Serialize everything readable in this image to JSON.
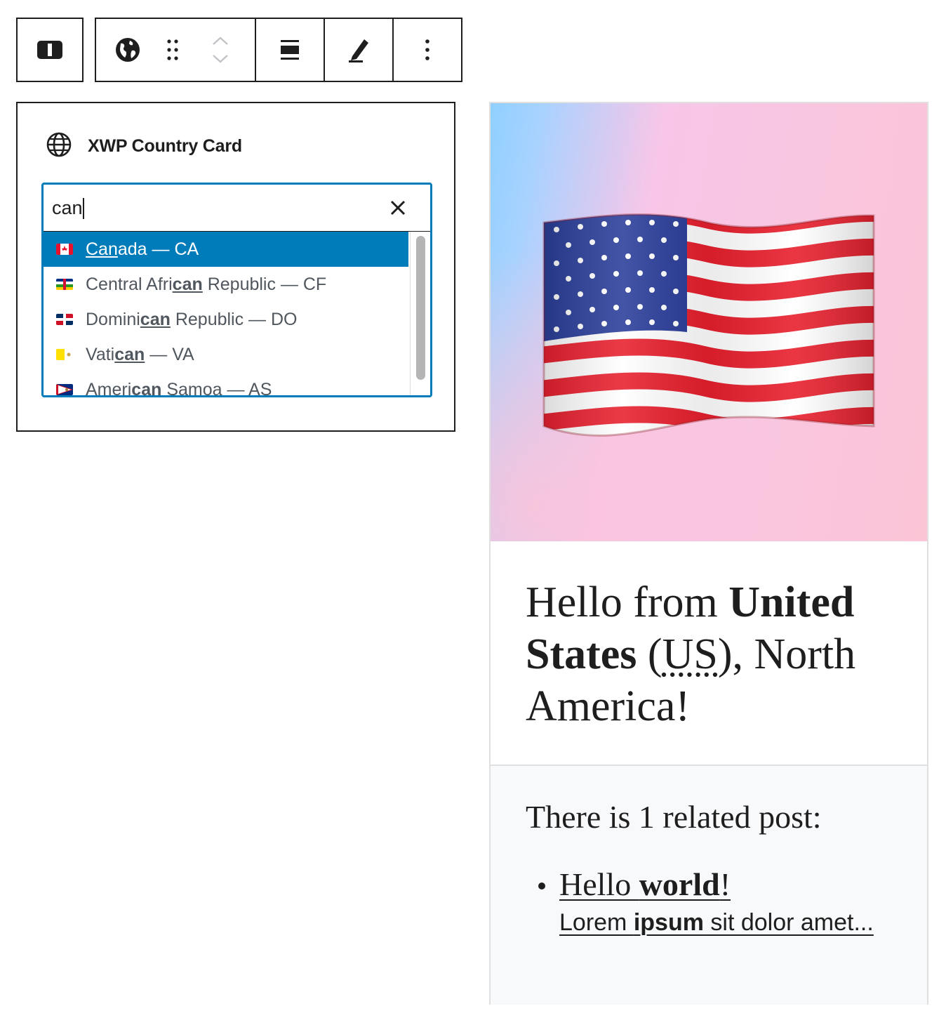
{
  "toolbar": {
    "parent_icon": "block-parent-icon",
    "block_icon": "globe-filled-icon",
    "drag_icon": "drag-handle-icon",
    "move_up_icon": "chevron-up-icon",
    "move_down_icon": "chevron-down-icon",
    "align_icon": "align-center-icon",
    "edit_icon": "pencil-icon",
    "more_icon": "more-vertical-icon"
  },
  "block": {
    "title": "XWP Country Card",
    "icon": "globe-icon"
  },
  "search": {
    "value": "can",
    "clear_icon": "close-icon"
  },
  "options": [
    {
      "pre": "",
      "match": "Can",
      "post": "ada — CA",
      "selected": true,
      "flag": "CA"
    },
    {
      "pre": "Central Afri",
      "match": "can",
      "post": " Republic — CF",
      "selected": false,
      "flag": "CF"
    },
    {
      "pre": "Domini",
      "match": "can",
      "post": " Republic — DO",
      "selected": false,
      "flag": "DO"
    },
    {
      "pre": "Vati",
      "match": "can",
      "post": " — VA",
      "selected": false,
      "flag": "VA"
    },
    {
      "pre": "Ameri",
      "match": "can",
      "post": " Samoa — AS",
      "selected": false,
      "flag": "AS"
    }
  ],
  "colors": {
    "accent": "#007cba",
    "text": "#1e1e1e",
    "muted_text": "#50575e"
  },
  "card": {
    "flag_emoji": "US flag",
    "greeting": {
      "prefix": "Hello from ",
      "country": "United States",
      "code_open": " (",
      "code": "US",
      "code_close": "), ",
      "continent": "North America",
      "suffix": "!"
    },
    "related": {
      "heading": "There is 1 related post:",
      "post_title_plain": "Hello ",
      "post_title_bold": "world",
      "post_title_end": "!",
      "excerpt_a": "Lorem ",
      "excerpt_b": "ipsum",
      "excerpt_c": " sit dolor amet..."
    }
  }
}
